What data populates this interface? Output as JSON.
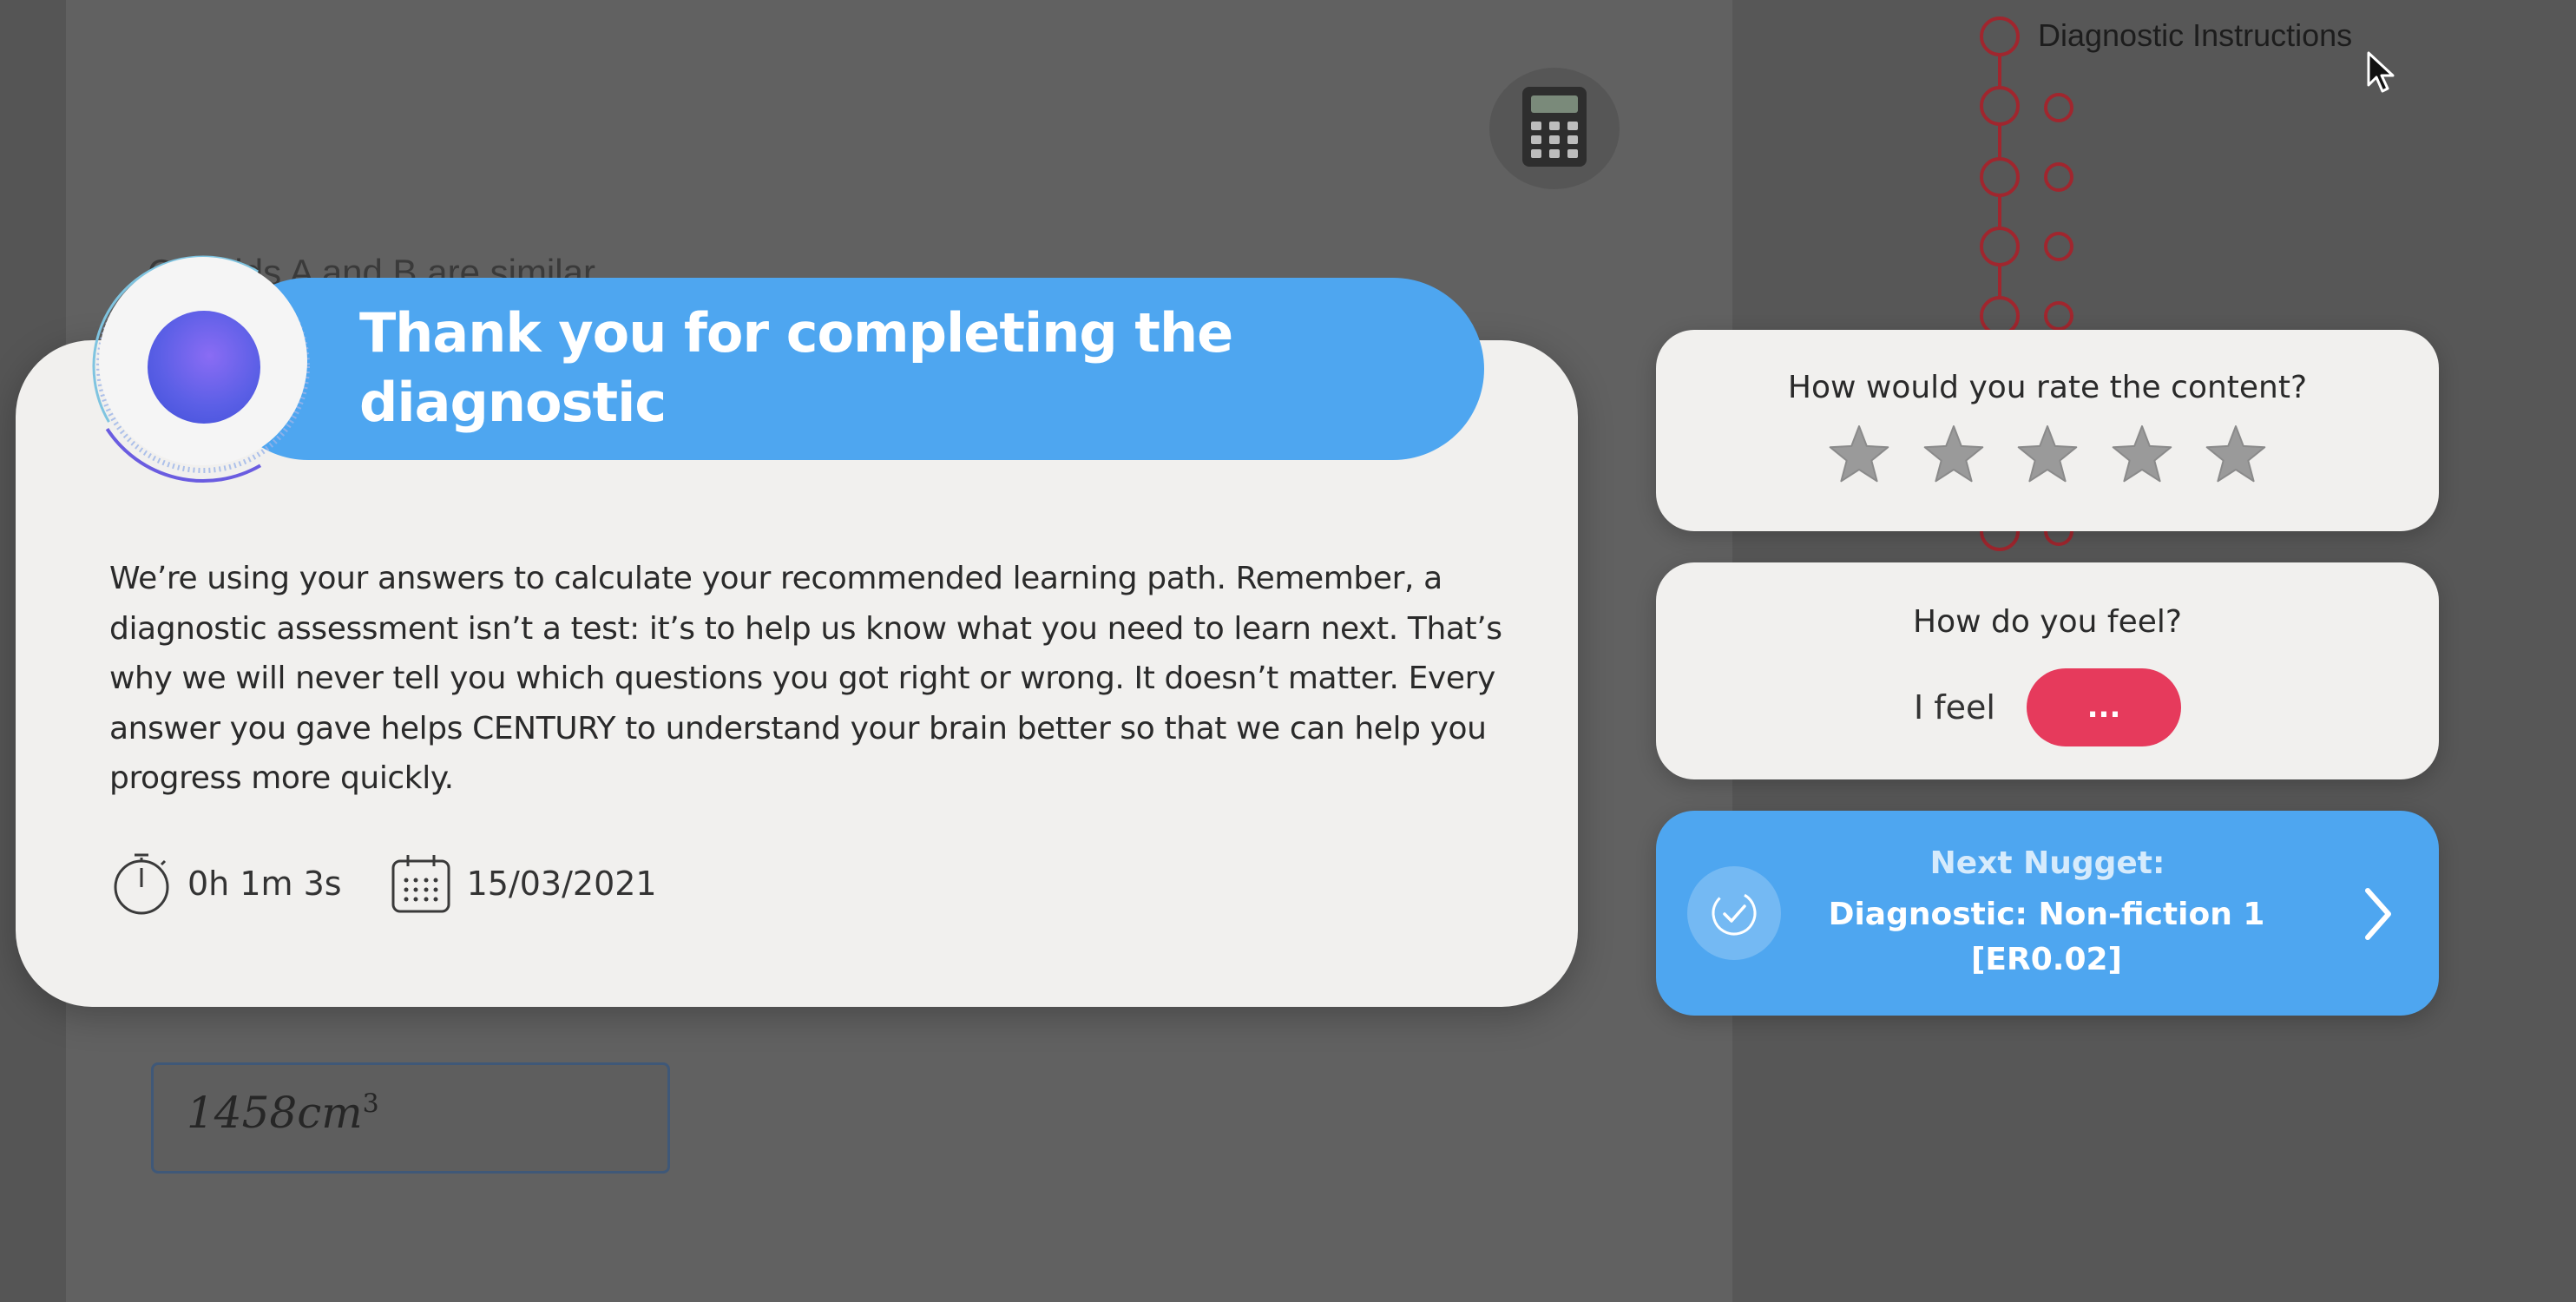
{
  "background": {
    "question_partial": "Cuboids A and B are similar",
    "answer_box_value": "1458cm",
    "answer_box_exponent": "3",
    "progress_label": "Diagnostic Instructions"
  },
  "modal": {
    "title": "Thank you for completing the diagnostic",
    "body": "We’re using your answers to calculate your recommended learning path. Remember, a diagnostic assessment isn’t a test: it’s to help us know what you need to learn next. That’s why we will never tell you which questions you got right or wrong. It doesn’t matter. Every answer you gave helps CENTURY to understand your brain better so that we can help you progress more quickly.",
    "duration": "0h 1m 3s",
    "date": "15/03/2021"
  },
  "rating": {
    "title": "How would you rate the content?",
    "max_stars": 5,
    "selected_stars": 0
  },
  "feeling": {
    "title": "How do you feel?",
    "label": "I feel",
    "button_label": "..."
  },
  "next_nugget": {
    "label": "Next Nugget:",
    "title": "Diagnostic: Non-fiction 1 [ER0.02]"
  },
  "colors": {
    "accent_blue": "#4ea6f0",
    "feel_pill": "#e63a5c",
    "progress_track": "#a0262e",
    "star_gray": "#9a9a9a",
    "badge_purple": "#5b5fe6"
  },
  "icons": {
    "calculator": "calculator-icon",
    "stopwatch": "stopwatch-icon",
    "calendar": "calendar-icon",
    "star": "star-icon",
    "check": "check-circle-icon",
    "chevron": "chevron-right-icon",
    "cursor": "mouse-cursor-icon"
  }
}
